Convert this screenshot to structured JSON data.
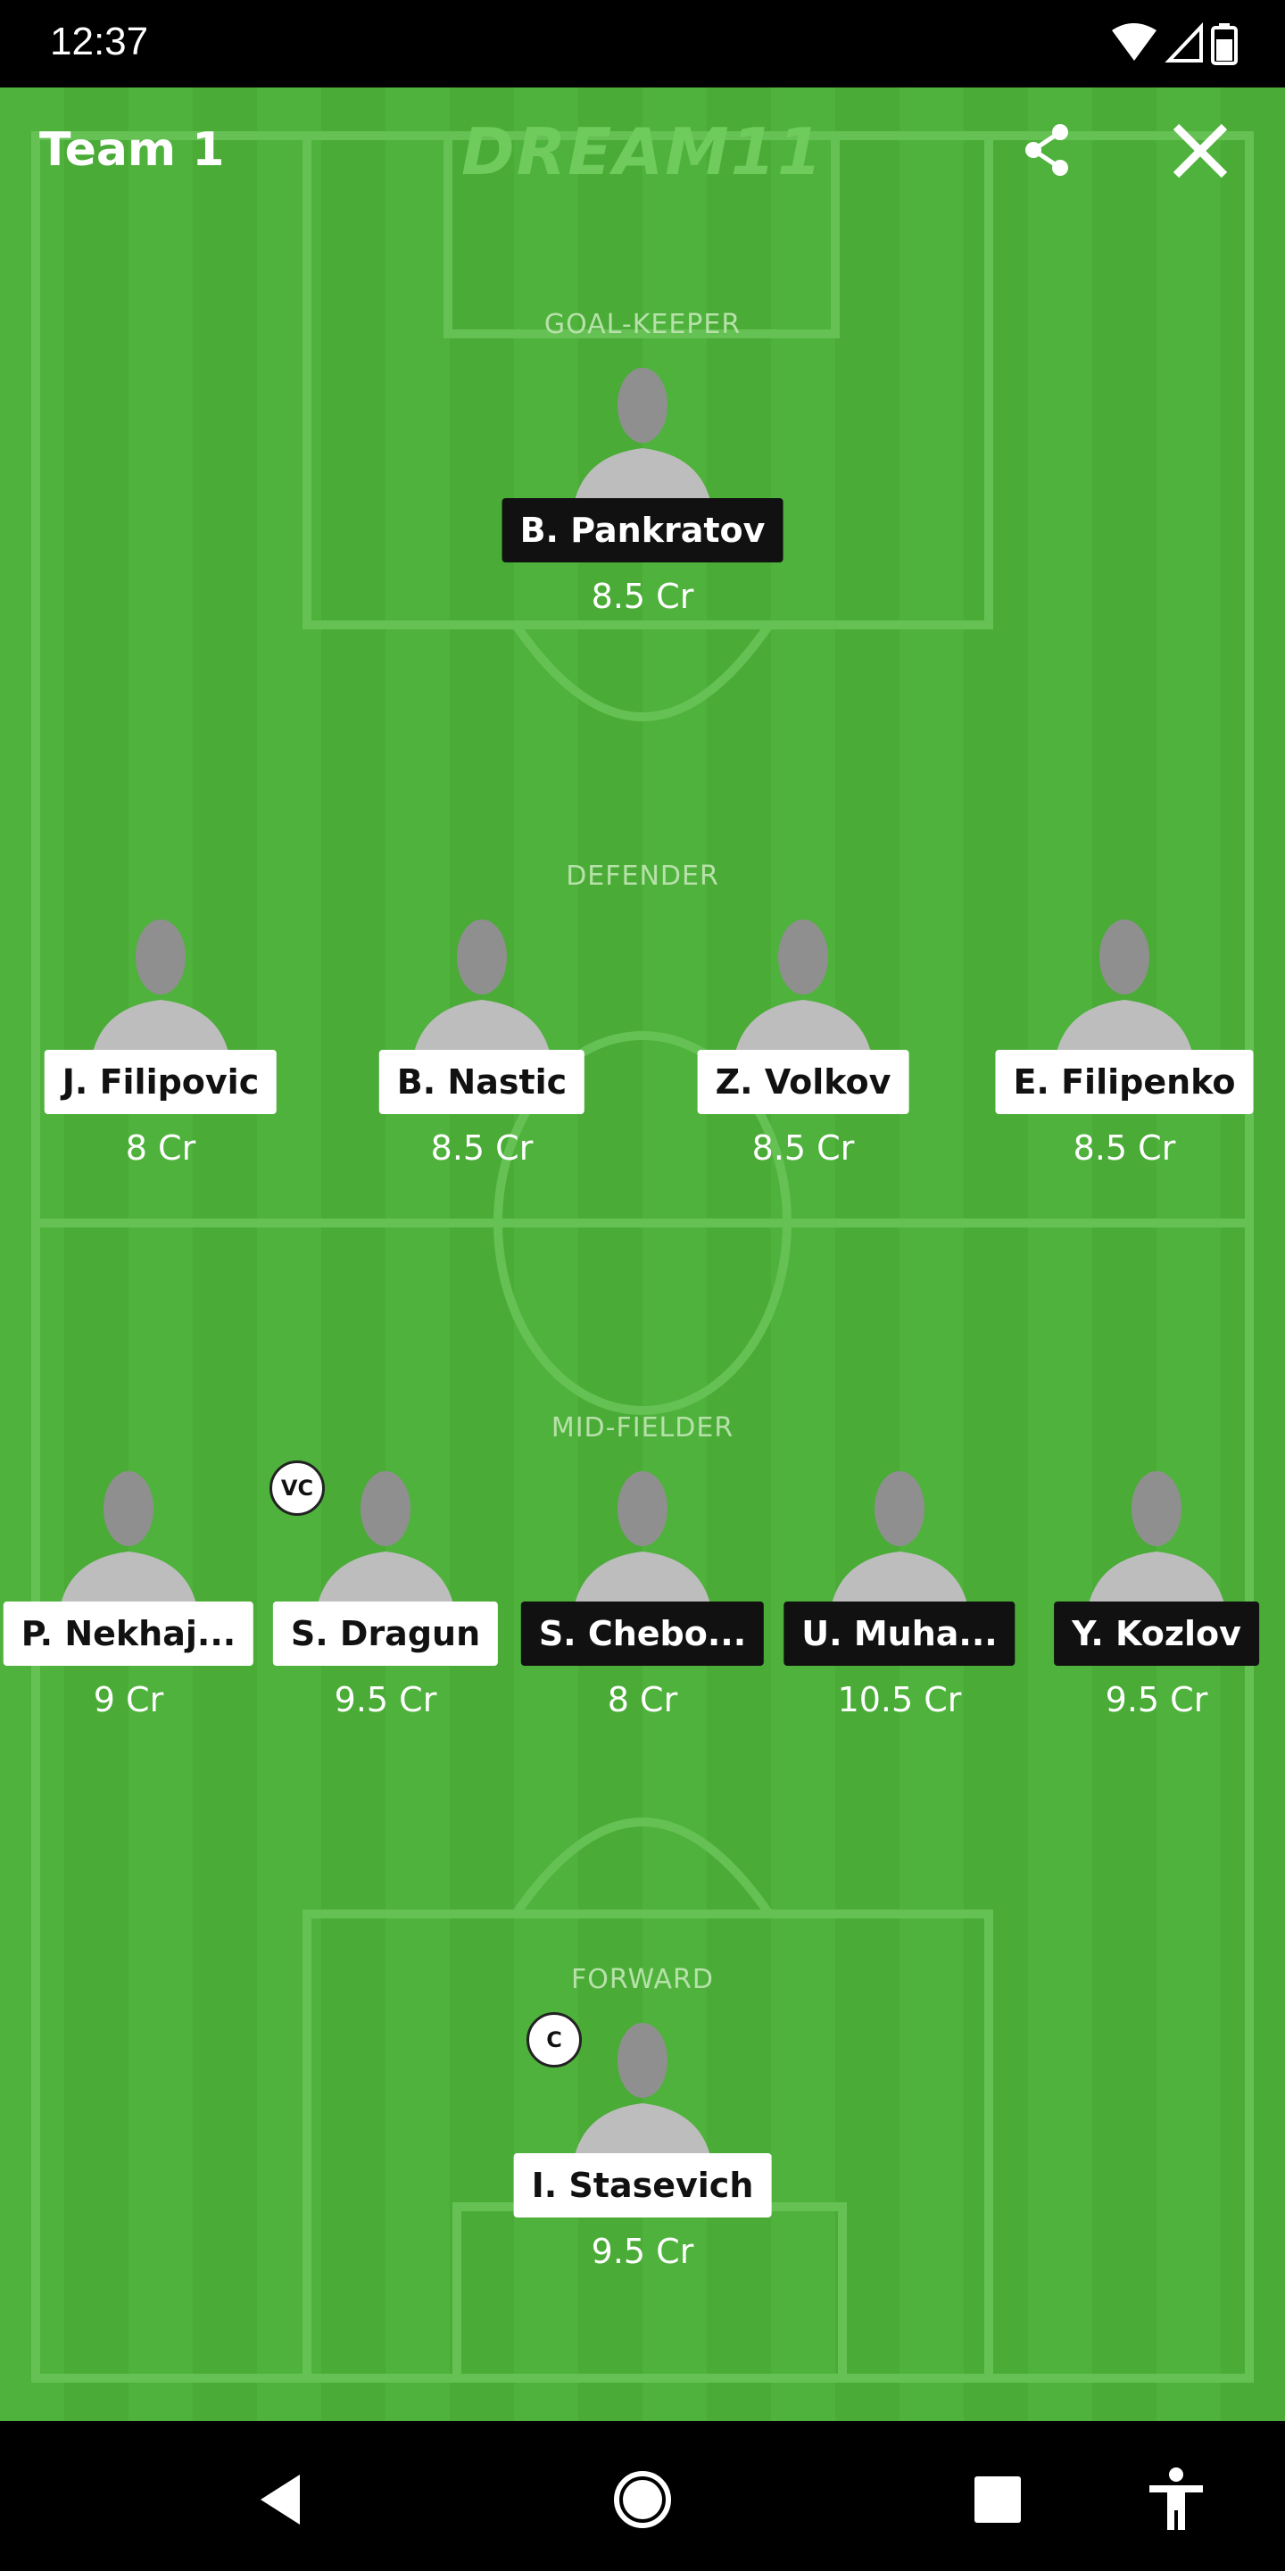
{
  "status_bar": {
    "time": "12:37"
  },
  "header": {
    "team_name": "Team 1",
    "brand": "DREAM11"
  },
  "colors": {
    "field_a": "#4fb23c",
    "field_b": "#4aab37",
    "dark_tag": "#111111",
    "light_tag": "#ffffff"
  },
  "sections": {
    "goalkeeper": "GOAL-KEEPER",
    "defender": "DEFENDER",
    "midfielder": "MID-FIELDER",
    "forward": "FORWARD"
  },
  "goalkeepers": [
    {
      "name": "B. Pankratov",
      "credits": "8.5 Cr",
      "tag": "dark"
    }
  ],
  "defenders": [
    {
      "name": "J. Filipovic",
      "credits": "8 Cr",
      "tag": "light"
    },
    {
      "name": "B. Nastic",
      "credits": "8.5 Cr",
      "tag": "light"
    },
    {
      "name": "Z. Volkov",
      "credits": "8.5 Cr",
      "tag": "light"
    },
    {
      "name": "E. Filipenko",
      "credits": "8.5 Cr",
      "tag": "light"
    }
  ],
  "midfielders": [
    {
      "name": "P. Nekhaj...",
      "credits": "9 Cr",
      "tag": "light"
    },
    {
      "name": "S. Dragun",
      "credits": "9.5 Cr",
      "tag": "light",
      "badge": "VC"
    },
    {
      "name": "S. Chebo...",
      "credits": "8 Cr",
      "tag": "dark"
    },
    {
      "name": "U. Muha...",
      "credits": "10.5 Cr",
      "tag": "dark"
    },
    {
      "name": "Y. Kozlov",
      "credits": "9.5 Cr",
      "tag": "dark"
    }
  ],
  "forwards": [
    {
      "name": "I. Stasevich",
      "credits": "9.5 Cr",
      "tag": "light",
      "badge": "C"
    }
  ]
}
